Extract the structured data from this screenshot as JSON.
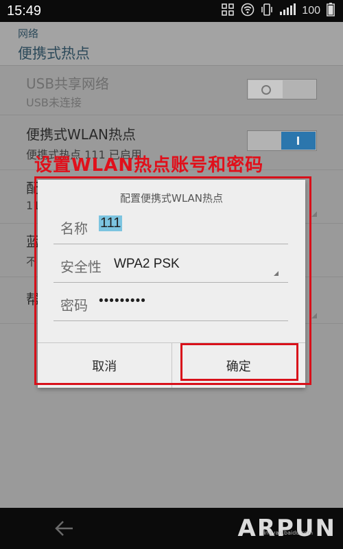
{
  "status_bar": {
    "time": "15:49",
    "battery": "100",
    "icons": [
      "screenshot-icon",
      "wifi-hotspot-icon",
      "vibrate-icon",
      "signal-icon",
      "battery-icon"
    ]
  },
  "header": {
    "back_label": "网络",
    "title": "便携式热点"
  },
  "list": {
    "usb": {
      "title": "USB共享网络",
      "subtitle": "USB未连接",
      "enabled": false
    },
    "wlan": {
      "title": "便携式WLAN热点",
      "subtitle": "便携式热点 111 已启用",
      "enabled": true
    },
    "row3": {
      "title": "配",
      "subtitle": "11"
    },
    "row4": {
      "title": "蓝",
      "subtitle": "不"
    },
    "row5": {
      "title": "帮"
    }
  },
  "annotation": {
    "caption": "设置WLAN热点账号和密码",
    "color": "#e0101b"
  },
  "dialog": {
    "title": "配置便携式WLAN热点",
    "name_label": "名称",
    "name_value": "111",
    "security_label": "安全性",
    "security_value": "WPA2 PSK",
    "password_label": "密码",
    "password_value": "•••••••••",
    "cancel_label": "取消",
    "confirm_label": "确定"
  },
  "watermark": {
    "text": "ARPUN",
    "url": "jingyan.baidu.com"
  },
  "colors": {
    "accent": "#2b76ad",
    "selection": "#7cc4e0",
    "annotation_red": "#d8101a"
  }
}
